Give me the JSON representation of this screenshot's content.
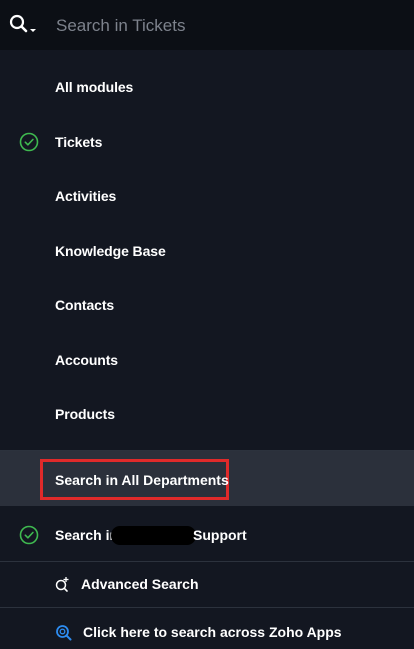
{
  "search": {
    "placeholder": "Search in Tickets",
    "value": ""
  },
  "modules": [
    {
      "label": "All modules",
      "checked": false
    },
    {
      "label": "Tickets",
      "checked": true
    },
    {
      "label": "Activities",
      "checked": false
    },
    {
      "label": "Knowledge Base",
      "checked": false
    },
    {
      "label": "Contacts",
      "checked": false
    },
    {
      "label": "Accounts",
      "checked": false
    },
    {
      "label": "Products",
      "checked": false
    }
  ],
  "scope": {
    "all_departments_label": "Search in All Departments",
    "support_prefix": "Search in",
    "support_suffix": "Support",
    "support_checked": true
  },
  "advanced_search_label": "Advanced Search",
  "zoho_apps_label": "Click here to search across Zoho Apps",
  "colors": {
    "accent_check": "#3fb950",
    "highlight_border": "#e02a2a",
    "zoho_icon": "#2d8cf0"
  }
}
